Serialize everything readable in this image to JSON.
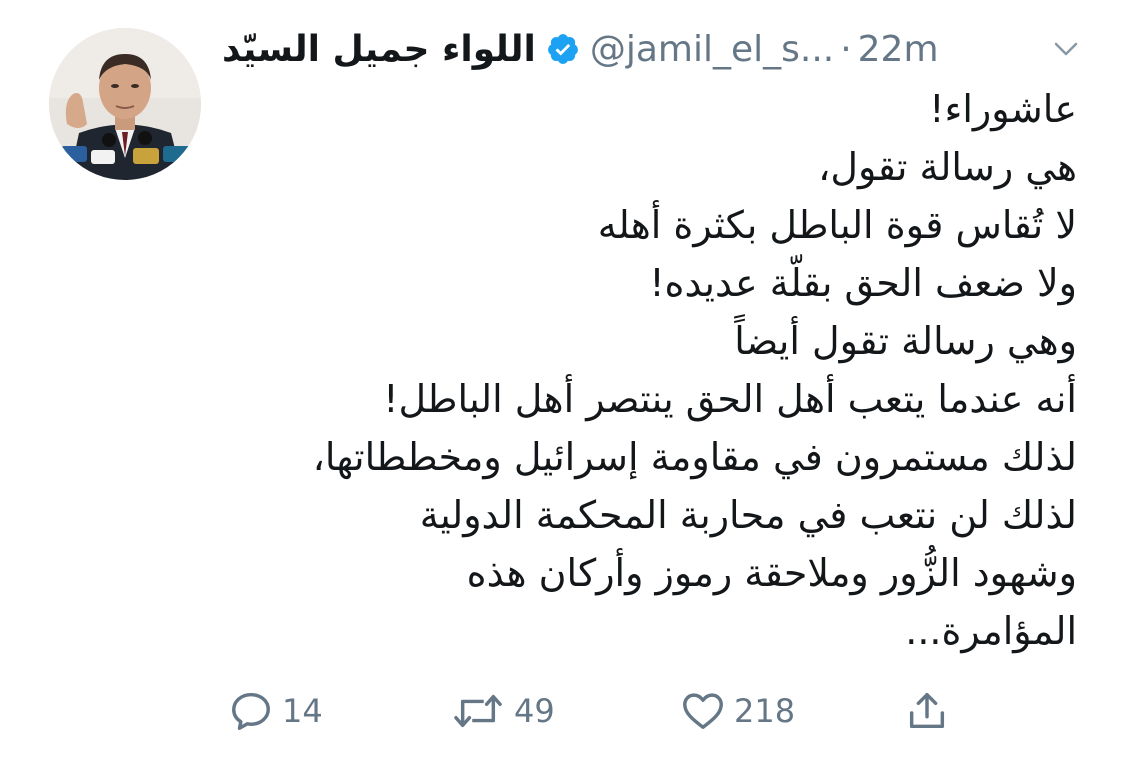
{
  "tweet": {
    "author": {
      "display_name": "اللواء جميل السيّد",
      "handle": "@jamil_el_s...",
      "verified": true
    },
    "separator": "·",
    "time": "22m",
    "header_menu_icon": "chevron-down-icon",
    "body_lines": [
      "عاشوراء!",
      "هي رسالة تقول،",
      "لا تُقاس قوة الباطل بكثرة أهله",
      "ولا ضعف الحق بقلّة عديده!",
      "وهي رسالة تقول أيضاً",
      "أنه عندما يتعب أهل الحق ينتصر أهل الباطل!",
      "لذلك مستمرون في مقاومة إسرائيل ومخططاتها،",
      "لذلك لن نتعب في محاربة المحكمة الدولية",
      "وشهود الزُّور  وملاحقة رموز وأركان هذه",
      "المؤامرة..."
    ],
    "actions": {
      "reply": {
        "icon": "reply-icon",
        "count": "14"
      },
      "retweet": {
        "icon": "retweet-icon",
        "count": "49"
      },
      "like": {
        "icon": "heart-icon",
        "count": "218"
      },
      "share": {
        "icon": "share-icon"
      }
    },
    "colors": {
      "text": "#14171a",
      "secondary": "#657786",
      "verified_blue": "#1da1f2"
    }
  }
}
